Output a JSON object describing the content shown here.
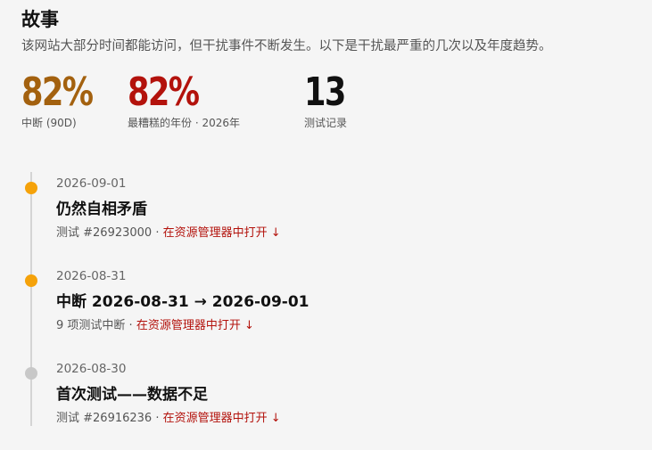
{
  "header": {
    "title": "故事",
    "subtitle": "该网站大部分时间都能访问，但干扰事件不断发生。以下是干扰最严重的几次以及年度趋势。"
  },
  "stats": [
    {
      "value": "82%",
      "label": "中断 (90D)",
      "color": "#a3610f"
    },
    {
      "value": "82%",
      "label": "最糟糕的年份 · 2026年",
      "color": "#b3120c"
    },
    {
      "value": "13",
      "label": "测试记录",
      "color": "#111111"
    }
  ],
  "timeline": {
    "items": [
      {
        "date": "2026-09-01",
        "heading": "仍然自相矛盾",
        "meta": "测试 #26923000 · ",
        "link": "在资源管理器中打开 ↓",
        "dot_color": "#f5a20a"
      },
      {
        "date": "2026-08-31",
        "heading": "中断 2026-08-31 → 2026-09-01",
        "meta": "9 项测试中断 · ",
        "link": "在资源管理器中打开 ↓",
        "dot_color": "#f5a20a"
      },
      {
        "date": "2026-08-30",
        "heading": "首次测试——数据不足",
        "meta": "测试 #26916236 · ",
        "link": "在资源管理器中打开 ↓",
        "dot_color": "#c8c8c8"
      }
    ]
  }
}
